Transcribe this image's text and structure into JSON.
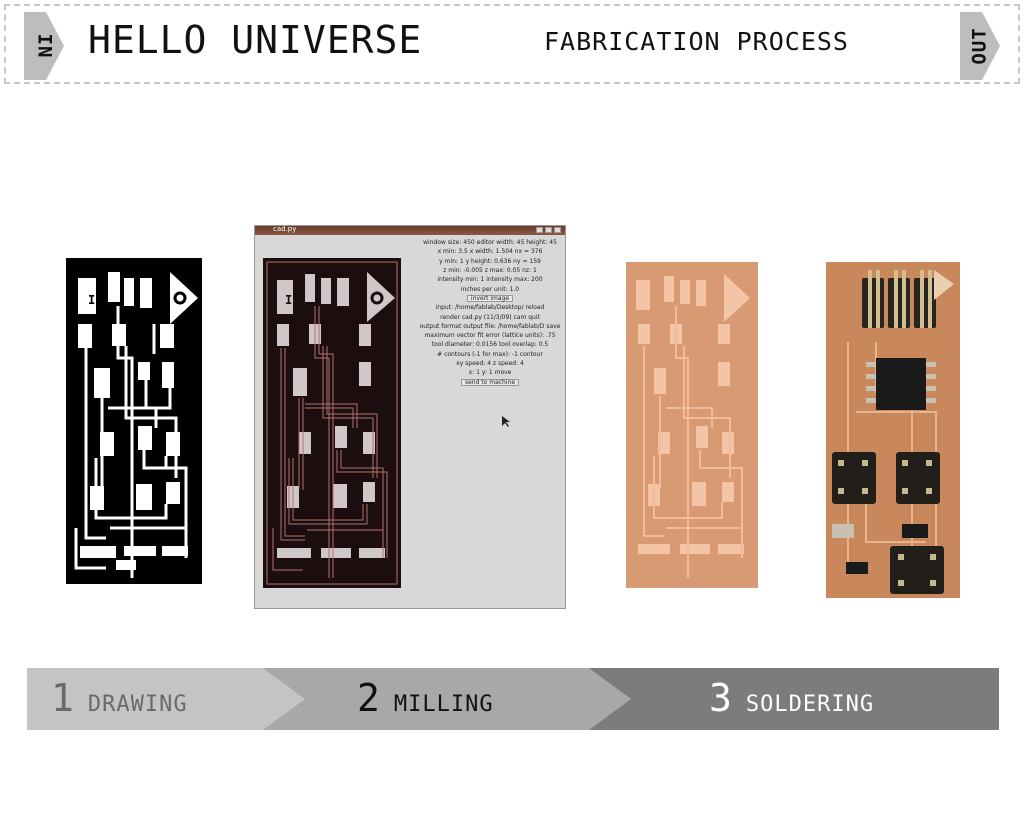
{
  "header": {
    "in_label": "IN",
    "title": "HELLO UNIVERSE",
    "subtitle": "FABRICATION PROCESS",
    "out_label": "OUT"
  },
  "panels": {
    "drawing_icon": "pcb-drawing-image",
    "screenshot_icon": "cad-software-screenshot",
    "milled_icon": "milled-board-photo",
    "soldered_icon": "soldered-board-photo"
  },
  "cad_window": {
    "title": "cad.py",
    "rows": [
      "window size: 450   editor width: 45   height: 45",
      "x min: 3.5   x width: 1.504   nx = 376",
      "y min: 1   y height: 0.636   ny = 159",
      "z min: -0.005   z max: 0.05   nz: 1",
      "intensity min: 1   intensity max: 200",
      "inches per unit: 1.0",
      "invert image",
      "input: /home/fablab/Desktop/   reload",
      "render   cad.py (11/3/09)   cam   quit",
      "output format   output file: /home/fablab/D   save",
      "maximum vector fit error (lattice units): .75",
      "tool diameter: 0.0156   tool overlap: 0.5",
      "# contours (-1 for max): -1   contour",
      "xy speed: 4   z speed: 4",
      "x: 1   y: 1   move",
      "send to machine"
    ]
  },
  "process": {
    "steps": [
      {
        "number": "1",
        "label": "DRAWING"
      },
      {
        "number": "2",
        "label": "MILLING"
      },
      {
        "number": "3",
        "label": "SOLDERING"
      }
    ],
    "colors": {
      "step1": "#c4c4c4",
      "step2": "#a8a8a8",
      "step3": "#7c7c7c"
    }
  }
}
